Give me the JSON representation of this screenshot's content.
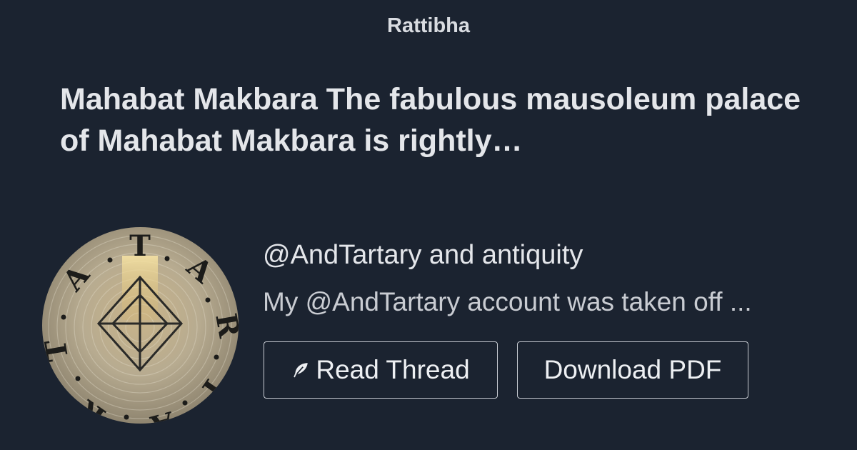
{
  "site": {
    "brand": "Rattibha"
  },
  "thread": {
    "title": "Mahabat Makbara The fabulous mausoleum palace of Mahabat Makbara is rightly…",
    "author": "@AndTartary and antiquity",
    "excerpt": "My @AndTartary account was taken off ..."
  },
  "avatar": {
    "letters": [
      "T",
      "A",
      "R",
      "T",
      "A",
      "R",
      "T",
      "A"
    ]
  },
  "actions": {
    "read_label": "Read Thread",
    "read_icon": "feather-icon",
    "pdf_label": "Download PDF"
  },
  "colors": {
    "background": "#1b2330",
    "text": "#e4e6ea",
    "button_border": "#c8ccd3"
  }
}
